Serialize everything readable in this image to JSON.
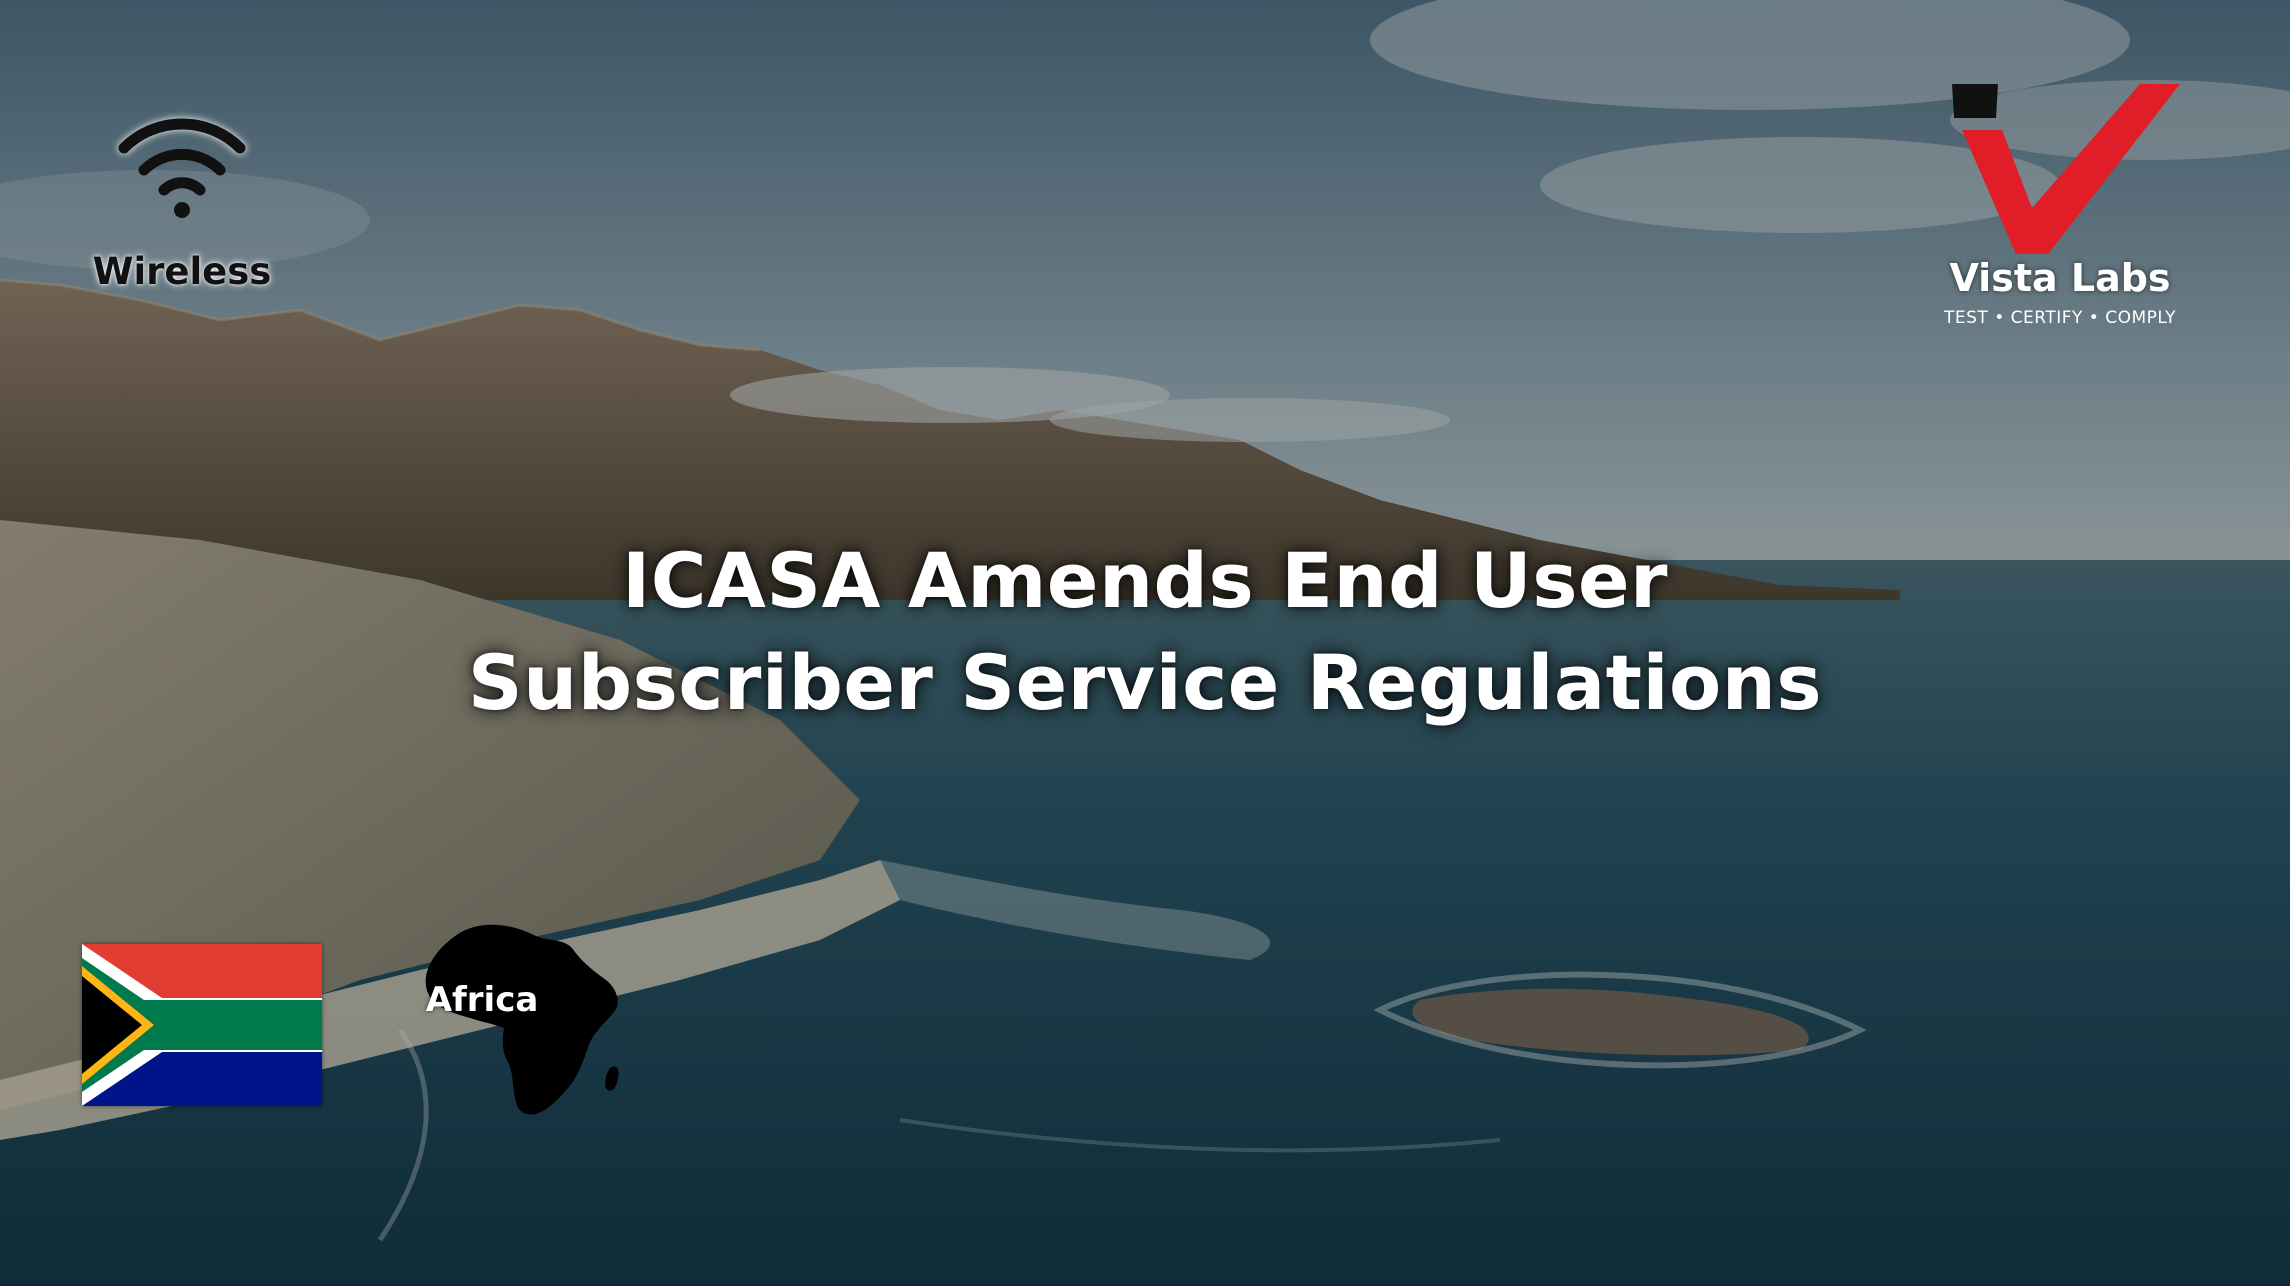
{
  "headline": {
    "line1": "ICASA Amends End User",
    "line2": "Subscriber Service Regulations"
  },
  "badges": {
    "wireless": {
      "icon": "wifi-icon",
      "label": "Wireless"
    },
    "africa": {
      "icon": "africa-map-icon",
      "label": "Africa"
    },
    "flag": {
      "icon": "south-africa-flag-icon"
    }
  },
  "logo": {
    "icon": "vista-labs-v-logo",
    "name": "Vista Labs",
    "tagline": "TEST • CERTIFY • COMPLY"
  },
  "colors": {
    "logo_red": "#e11d27",
    "logo_black": "#111111",
    "flag_red": "#e03c31",
    "flag_blue": "#001489",
    "flag_green": "#007a4d",
    "flag_yellow": "#ffb612",
    "ocean": "#1e4a5e"
  }
}
